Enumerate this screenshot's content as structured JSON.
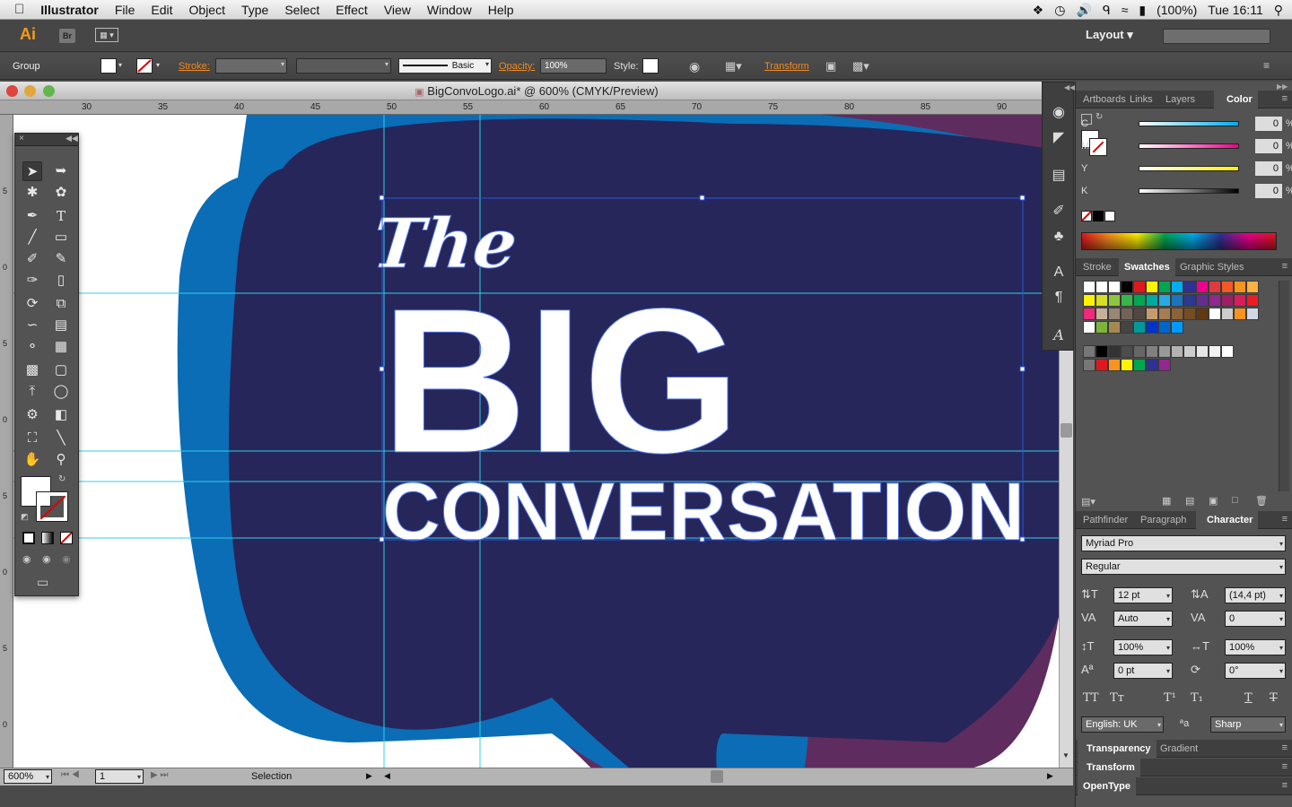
{
  "menubar": {
    "app": "Illustrator",
    "items": [
      "File",
      "Edit",
      "Object",
      "Type",
      "Select",
      "Effect",
      "View",
      "Window",
      "Help"
    ],
    "battery": "(100%)",
    "clock": "Tue 16:11"
  },
  "appbar": {
    "logo": "Ai",
    "bridge": "Br",
    "workspace": "Layout"
  },
  "control": {
    "selection_type": "Group",
    "stroke_label": "Stroke:",
    "brush": "Basic",
    "opacity_label": "Opacity:",
    "opacity": "100%",
    "style_label": "Style:",
    "transform_label": "Transform"
  },
  "document": {
    "title": "BigConvoLogo.ai* @ 600% (CMYK/Preview)",
    "ruler_ticks": [
      "30",
      "35",
      "40",
      "45",
      "50",
      "55",
      "60",
      "65",
      "70",
      "75",
      "80",
      "85",
      "90"
    ],
    "vruler_ticks": [
      "5",
      "0",
      "5",
      "0",
      "5",
      "0",
      "5",
      "0",
      "5"
    ],
    "artwork": {
      "line1": "The",
      "line2": "BIG",
      "line3": "CONVERSATION"
    },
    "colors": {
      "navy": "#26265a",
      "plum": "#5f2c5f",
      "blue": "#0a6db6"
    }
  },
  "status": {
    "zoom": "600%",
    "artboard": "1",
    "tool": "Selection"
  },
  "panels": {
    "color_tabs": [
      "Artboards",
      "Links",
      "Layers",
      "Color"
    ],
    "cmyk": [
      {
        "ch": "C",
        "val": "0",
        "pct": "%"
      },
      {
        "ch": "M",
        "val": "0",
        "pct": "%"
      },
      {
        "ch": "Y",
        "val": "0",
        "pct": "%"
      },
      {
        "ch": "K",
        "val": "0",
        "pct": "%"
      }
    ],
    "swatch_tabs": [
      "Stroke",
      "Swatches",
      "Graphic Styles"
    ],
    "char_tabs": [
      "Pathfinder",
      "Paragraph",
      "Character"
    ],
    "font_family": "Myriad Pro",
    "font_style": "Regular",
    "font_size": "12 pt",
    "leading": "(14,4 pt)",
    "kerning": "Auto",
    "tracking": "0",
    "vscale": "100%",
    "hscale": "100%",
    "baseline": "0 pt",
    "rotation": "0°",
    "language": "English: UK",
    "antialias": "Sharp",
    "aa_label": "ªa",
    "transparency_tabs": [
      "Transparency",
      "Gradient"
    ],
    "transform_tab": "Transform",
    "opentype_tab": "OpenType"
  }
}
